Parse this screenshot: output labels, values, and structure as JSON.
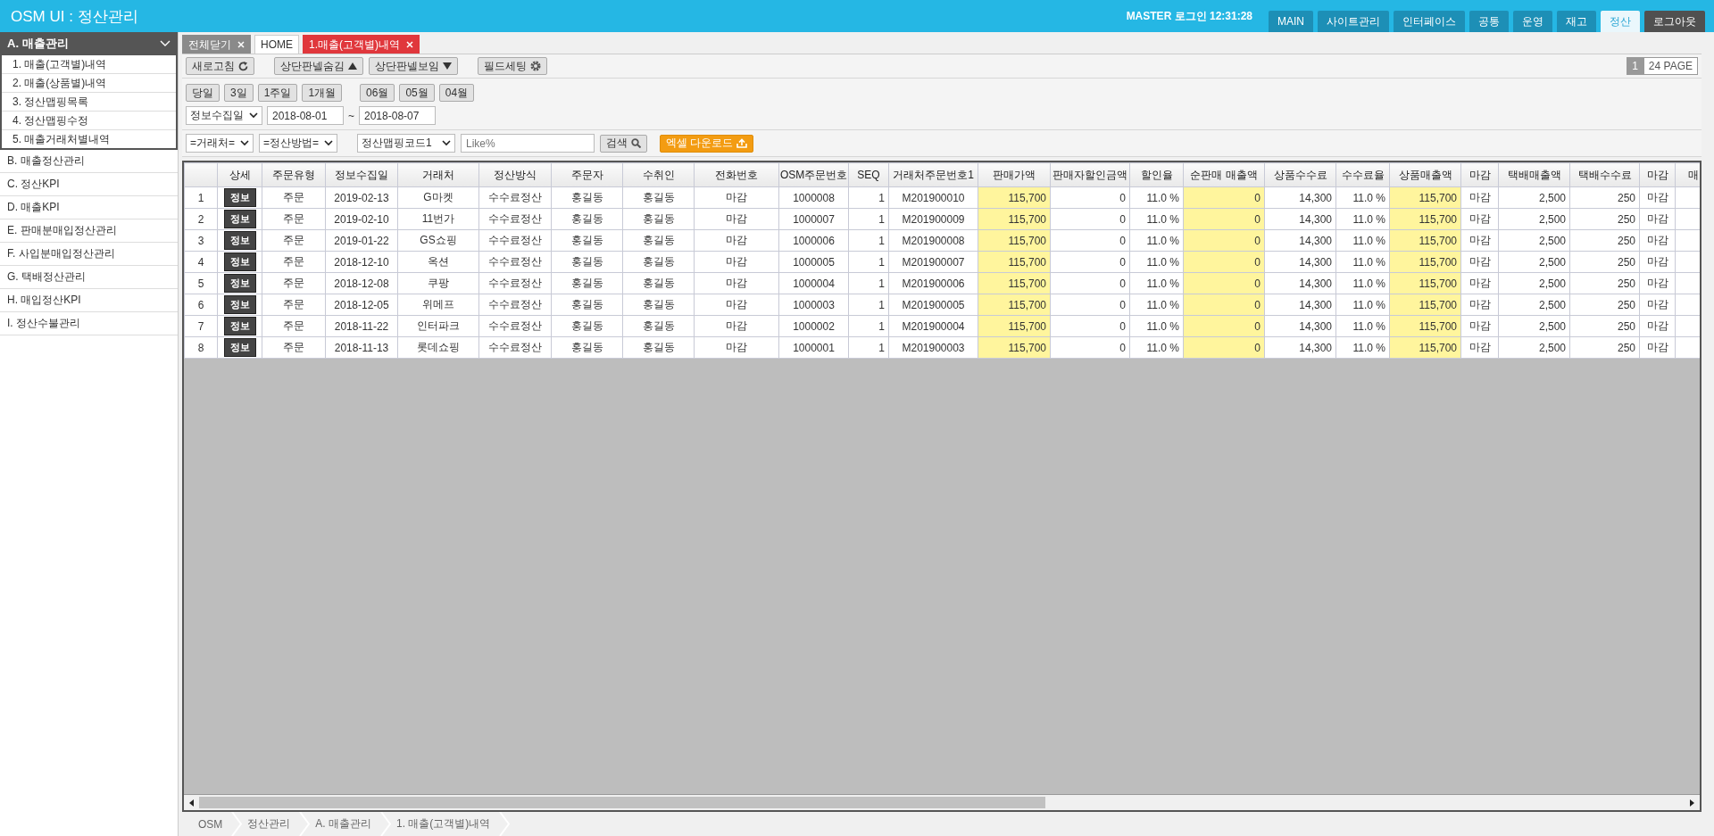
{
  "header": {
    "title": "OSM UI : 정산관리",
    "user": "MASTER 로그인 12:31:28",
    "nav": [
      {
        "label": "MAIN",
        "kind": "menu",
        "selected": false
      },
      {
        "label": "사이트관리",
        "kind": "menu",
        "selected": false
      },
      {
        "label": "인터페이스",
        "kind": "menu",
        "selected": false
      },
      {
        "label": "공통",
        "kind": "menu",
        "selected": false
      },
      {
        "label": "운영",
        "kind": "menu",
        "selected": false
      },
      {
        "label": "재고",
        "kind": "menu",
        "selected": false
      },
      {
        "label": "정산",
        "kind": "menu",
        "selected": true
      },
      {
        "label": "로그아웃",
        "kind": "logout",
        "selected": false
      }
    ]
  },
  "sidebar": {
    "groups": [
      {
        "label": "A. 매출관리",
        "expanded": true,
        "children": [
          {
            "label": "1. 매출(고객별)내역"
          },
          {
            "label": "2. 매출(상품별)내역"
          },
          {
            "label": "3. 정산맵핑목록"
          },
          {
            "label": "4. 정산맵핑수정"
          },
          {
            "label": "5. 매출거래처별내역"
          }
        ]
      },
      {
        "label": "B. 매출정산관리",
        "expanded": false
      },
      {
        "label": "C. 정산KPI",
        "expanded": false
      },
      {
        "label": "D. 매출KPI",
        "expanded": false
      },
      {
        "label": "E. 판매분매입정산관리",
        "expanded": false
      },
      {
        "label": "F. 사입분매입정산관리",
        "expanded": false
      },
      {
        "label": "G. 택배정산관리",
        "expanded": false
      },
      {
        "label": "H. 매입정산KPI",
        "expanded": false
      },
      {
        "label": "I. 정산수불관리",
        "expanded": false
      }
    ]
  },
  "doc_tabs": [
    {
      "label": "전체닫기",
      "kind": "close-all",
      "selected": false
    },
    {
      "label": "HOME",
      "kind": "home",
      "selected": false
    },
    {
      "label": "1.매출(고객별)내역",
      "kind": "page",
      "selected": true
    }
  ],
  "toolbar": {
    "buttons": [
      {
        "label": "새로고침"
      },
      {
        "label": "상단판넬숨김"
      },
      {
        "label": "상단판넬보임"
      },
      {
        "label": "필드세팅"
      }
    ],
    "pager": [
      {
        "label": "1",
        "selected": true
      },
      {
        "label": "24 PAGE",
        "selected": false
      }
    ]
  },
  "period": {
    "range_buttons": [
      "당일",
      "3일",
      "1주일",
      "1개월"
    ],
    "month_buttons": [
      "06월",
      "05월",
      "04월"
    ],
    "date_type": "정보수집일",
    "date_from": "2018-08-01",
    "separator": "~",
    "date_to": "2018-08-07"
  },
  "filters": {
    "selects": [
      "=거래처=",
      "=정산방법="
    ],
    "code_select": "정산맵핑코드1",
    "search_placeholder": "Like%",
    "search_button": "검색",
    "excel_button": "엑셀 다운로드"
  },
  "table": {
    "columns": [
      {
        "kind": "num",
        "highlight": false
      },
      {
        "label": "상세",
        "kind": "button",
        "highlight": false
      },
      {
        "label": "주문유형",
        "kind": "text",
        "highlight": false
      },
      {
        "label": "정보수집일",
        "kind": "text",
        "highlight": false
      },
      {
        "label": "거래처",
        "kind": "text",
        "highlight": false
      },
      {
        "label": "정산방식",
        "kind": "text",
        "highlight": false
      },
      {
        "label": "주문자",
        "kind": "text",
        "highlight": false
      },
      {
        "label": "수취인",
        "kind": "text",
        "highlight": false
      },
      {
        "label": "전화번호",
        "kind": "text",
        "highlight": false
      },
      {
        "label": "OSM주문번호",
        "kind": "text",
        "highlight": false
      },
      {
        "label": "SEQ",
        "kind": "number",
        "highlight": false
      },
      {
        "label": "거래처주문번호1",
        "kind": "text",
        "highlight": false
      },
      {
        "label": "판매가액",
        "kind": "number",
        "highlight": true
      },
      {
        "label": "판매자할인금액",
        "kind": "number",
        "highlight": false
      },
      {
        "label": "할인율",
        "kind": "number",
        "highlight": false
      },
      {
        "label": "순판매 매출액",
        "kind": "number",
        "highlight": true
      },
      {
        "label": "상품수수료",
        "kind": "number",
        "highlight": false
      },
      {
        "label": "수수료율",
        "kind": "number",
        "highlight": false
      },
      {
        "label": "상품매출액",
        "kind": "number",
        "highlight": true
      },
      {
        "label": "마감",
        "kind": "text",
        "highlight": false
      },
      {
        "label": "택배매출액",
        "kind": "number",
        "highlight": false
      },
      {
        "label": "택배수수료",
        "kind": "number",
        "highlight": false
      },
      {
        "label": "마감",
        "kind": "text",
        "highlight": false
      },
      {
        "label": "매",
        "kind": "text",
        "highlight": false
      }
    ],
    "rows": [
      [
        "1",
        "정보",
        "주문",
        "2019-02-13",
        "G마켓",
        "수수료정산",
        "홍길동",
        "홍길동",
        "마감",
        "1000008",
        "1",
        "M201900010",
        "115,700",
        "0",
        "11.0 %",
        "0",
        "14,300",
        "11.0 %",
        "115,700",
        "마감",
        "2,500",
        "250",
        "마감"
      ],
      [
        "2",
        "정보",
        "주문",
        "2019-02-10",
        "11번가",
        "수수료정산",
        "홍길동",
        "홍길동",
        "마감",
        "1000007",
        "1",
        "M201900009",
        "115,700",
        "0",
        "11.0 %",
        "0",
        "14,300",
        "11.0 %",
        "115,700",
        "마감",
        "2,500",
        "250",
        "마감"
      ],
      [
        "3",
        "정보",
        "주문",
        "2019-01-22",
        "GS쇼핑",
        "수수료정산",
        "홍길동",
        "홍길동",
        "마감",
        "1000006",
        "1",
        "M201900008",
        "115,700",
        "0",
        "11.0 %",
        "0",
        "14,300",
        "11.0 %",
        "115,700",
        "마감",
        "2,500",
        "250",
        "마감"
      ],
      [
        "4",
        "정보",
        "주문",
        "2018-12-10",
        "옥션",
        "수수료정산",
        "홍길동",
        "홍길동",
        "마감",
        "1000005",
        "1",
        "M201900007",
        "115,700",
        "0",
        "11.0 %",
        "0",
        "14,300",
        "11.0 %",
        "115,700",
        "마감",
        "2,500",
        "250",
        "마감"
      ],
      [
        "5",
        "정보",
        "주문",
        "2018-12-08",
        "쿠팡",
        "수수료정산",
        "홍길동",
        "홍길동",
        "마감",
        "1000004",
        "1",
        "M201900006",
        "115,700",
        "0",
        "11.0 %",
        "0",
        "14,300",
        "11.0 %",
        "115,700",
        "마감",
        "2,500",
        "250",
        "마감"
      ],
      [
        "6",
        "정보",
        "주문",
        "2018-12-05",
        "위메프",
        "수수료정산",
        "홍길동",
        "홍길동",
        "마감",
        "1000003",
        "1",
        "M201900005",
        "115,700",
        "0",
        "11.0 %",
        "0",
        "14,300",
        "11.0 %",
        "115,700",
        "마감",
        "2,500",
        "250",
        "마감"
      ],
      [
        "7",
        "정보",
        "주문",
        "2018-11-22",
        "인터파크",
        "수수료정산",
        "홍길동",
        "홍길동",
        "마감",
        "1000002",
        "1",
        "M201900004",
        "115,700",
        "0",
        "11.0 %",
        "0",
        "14,300",
        "11.0 %",
        "115,700",
        "마감",
        "2,500",
        "250",
        "마감"
      ],
      [
        "8",
        "정보",
        "주문",
        "2018-11-13",
        "롯데쇼핑",
        "수수료정산",
        "홍길동",
        "홍길동",
        "마감",
        "1000001",
        "1",
        "M201900003",
        "115,700",
        "0",
        "11.0 %",
        "0",
        "14,300",
        "11.0 %",
        "115,700",
        "마감",
        "2,500",
        "250",
        "마감"
      ]
    ]
  },
  "breadcrumb": [
    "OSM",
    "정산관리",
    "A. 매출관리",
    "1. 매출(고객별)내역"
  ]
}
